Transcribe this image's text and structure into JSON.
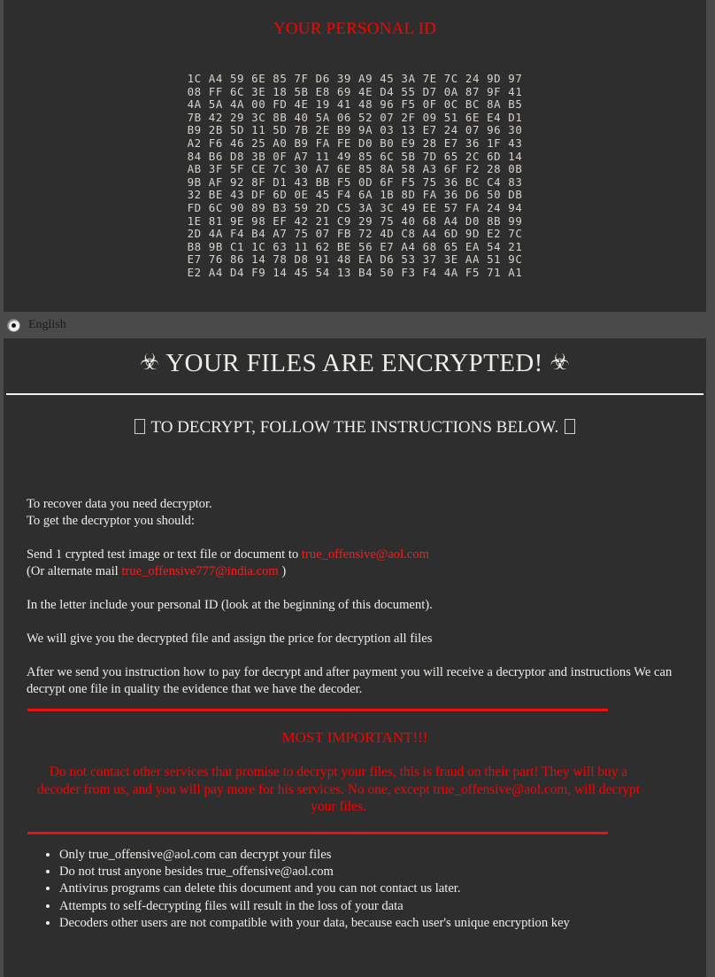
{
  "personal_id": {
    "title": "YOUR PERSONAL ID",
    "hex_rows": [
      "1C A4 59 6E 85 7F D6 39 A9 45 3A 7E 7C 24 9D 97",
      "08 FF 6C 3E 18 5B E8 69 4E D4 55 D7 0A 87 9F 41",
      "4A 5A 4A 00 FD 4E 19 41 48 96 F5 0F 0C BC 8A B5",
      "7B 42 29 3C 8B 40 5A 06 52 07 2F 09 51 6E E4 D1",
      "B9 2B 5D 11 5D 7B 2E B9 9A 03 13 E7 24 07 96 30",
      "A2 F6 46 25 A0 B9 FA FE D0 B0 E9 28 E7 36 1F 43",
      "84 B6 D8 3B 0F A7 11 49 85 6C 5B 7D 65 2C 6D 14",
      "AB 3F 5F CE 7C 30 A7 6E 85 8A 58 A3 6F F2 28 0B",
      "9B AF 92 8F D1 43 BB F5 0D 6F F5 75 36 BC C4 83",
      "32 BE 43 DF 6D 0E 45 F4 6A 1B 8D FA 36 D6 50 DB",
      "FD 6C 90 89 B3 59 2D C5 3A 3C 49 EE 57 FA 24 94",
      "1E 81 9E 98 EF 42 21 C9 29 75 40 68 A4 D0 8B 99",
      "2D 4A F4 B4 A7 75 07 FB 72 4D C8 A4 6D 9D E2 7C",
      "B8 9B C1 1C 63 11 62 BE 56 E7 A4 68 65 EA 54 21",
      "E7 76 86 14 78 D8 91 48 EA D6 53 37 3E AA 51 9C",
      "E2 A4 D4 F9 14 45 54 13 B4 50 F3 F4 4A F5 71 A1"
    ]
  },
  "language_bar": {
    "selected_language": "English"
  },
  "headings": {
    "biohazard_glyph": "☣",
    "encrypted_title": "YOUR FILES ARE ENCRYPTED!",
    "decrypt_subtitle": "TO DECRYPT, FOLLOW THE INSTRUCTIONS BELOW."
  },
  "body": {
    "line_recover": "To recover data you need decryptor.",
    "line_get": "To get the decryptor you should:",
    "send_prefix": "Send 1 crypted test image or text file or document to ",
    "primary_email": "true_offensive@aol.com",
    "alternate_prefix": "(Or alternate mail ",
    "alternate_email": "true_offensive777@india.com",
    "alternate_suffix": " )",
    "include_id": "In the letter include your personal ID (look at the beginning of this document).",
    "price_info": "We will give you the decrypted file and assign the price for decryption all files",
    "payment_info_line1": "After we send you instruction how to pay for decrypt and after payment you will receive a decryptor and",
    "payment_info_line2": "instructions We can decrypt one file in quality the evidence that we have the decoder."
  },
  "warning": {
    "most_important_title": "MOST IMPORTANT!!!",
    "fraud_text": "Do not contact other services that promise to decrypt your files, this is fraud on their part! They will buy a decoder from us, and you will pay more for his services. No one, except true_offensive@aol.com, will decrypt your files."
  },
  "bullets": [
    "Only true_offensive@aol.com can decrypt your files",
    "Do not trust anyone besides true_offensive@aol.com",
    "Antivirus programs can delete this document and you can not contact us later.",
    "Attempts to self-decrypting files will result in the loss of your data",
    "Decoders other users are not compatible with your data, because each user's unique encryption key"
  ],
  "colors": {
    "background": "#2e2e2e",
    "gutter": "#4a4a4a",
    "alert_red": "#ff0000",
    "rule_red": "#e81313",
    "body_text": "#efeee9",
    "hex_text": "#d8d4cc"
  }
}
